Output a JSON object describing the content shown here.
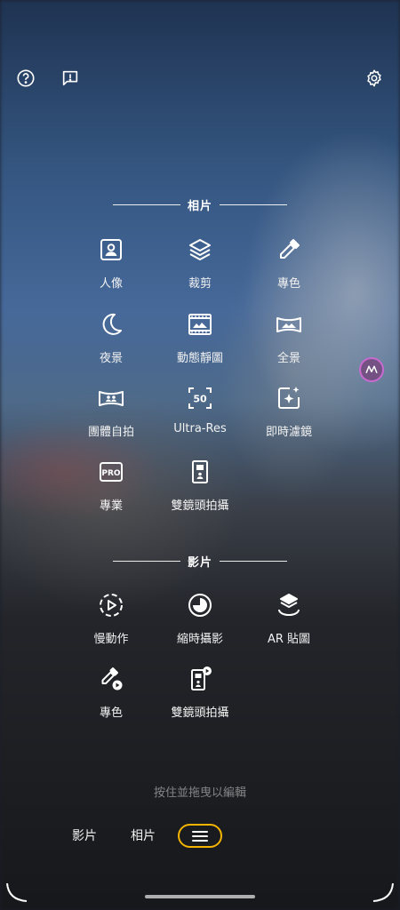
{
  "top_bar": {
    "help_icon": "help-circle-icon",
    "feedback_icon": "feedback-icon",
    "settings_icon": "gear-icon"
  },
  "photo_section": {
    "title": "相片",
    "modes": [
      {
        "label": "人像",
        "icon": "portrait-icon"
      },
      {
        "label": "裁剪",
        "icon": "crop-layers-icon"
      },
      {
        "label": "專色",
        "icon": "eyedropper-icon"
      },
      {
        "label": "夜景",
        "icon": "moon-icon"
      },
      {
        "label": "動態靜圖",
        "icon": "film-photo-icon"
      },
      {
        "label": "全景",
        "icon": "panorama-icon"
      },
      {
        "label": "團體自拍",
        "icon": "group-selfie-icon"
      },
      {
        "label": "Ultra-Res",
        "icon": "ultra-res-50-icon"
      },
      {
        "label": "即時濾鏡",
        "icon": "sparkle-filter-icon"
      },
      {
        "label": "專業",
        "icon": "pro-icon"
      },
      {
        "label": "雙鏡頭拍攝",
        "icon": "dual-capture-icon"
      }
    ]
  },
  "video_section": {
    "title": "影片",
    "modes": [
      {
        "label": "慢動作",
        "icon": "slow-motion-icon"
      },
      {
        "label": "縮時攝影",
        "icon": "timelapse-icon"
      },
      {
        "label": "AR 貼圖",
        "icon": "ar-stickers-icon"
      },
      {
        "label": "專色",
        "icon": "eyedropper-video-icon"
      },
      {
        "label": "雙鏡頭拍攝",
        "icon": "dual-capture-video-icon"
      }
    ]
  },
  "hint": "按住並拖曳以編輯",
  "bottom_bar": {
    "tabs": [
      {
        "label": "影片"
      },
      {
        "label": "相片"
      }
    ],
    "menu_icon": "hamburger-menu-icon",
    "accent": "#f5b400"
  }
}
